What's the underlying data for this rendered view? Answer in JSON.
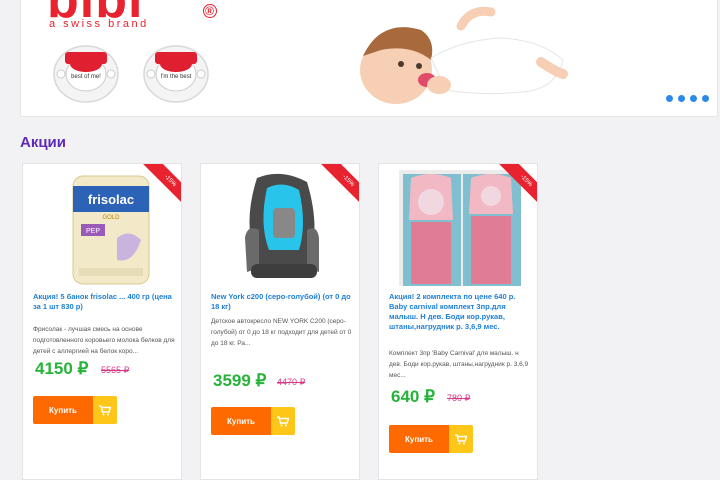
{
  "banner": {
    "brand": "bibi",
    "reg_mark": "®",
    "tagline": "a swiss brand",
    "pacifier_text_left": "best of me!",
    "pacifier_text_right": "I'm the best",
    "slider_dots": 4
  },
  "section": {
    "title": "Акции"
  },
  "products": [
    {
      "title": "Акция! 5 банок frisolac ... 400 гр (цена за 1 шт 830 р)",
      "desc": "Фрисолак - лучшая смесь на основе подготовленного коровьего молока белков для детей с аллергией на белок коро...",
      "price": "4150 ₽",
      "old_price": "5565 ₽",
      "buy_label": "Купить",
      "ribbon": "-15%",
      "image_brand": "frisolac",
      "image_sub": "GOLD",
      "image_label": "PEP"
    },
    {
      "title": "New York c200 (серо-голубой) (от 0 до 18 кг)",
      "desc": "Детское автокресло NEW YORK C200 (серо-голубой) от 0 до 18 кг подходит для детей от 0 до 18 кг. Ра...",
      "price": "3599 ₽",
      "old_price": "4470 ₽",
      "buy_label": "Купить",
      "ribbon": "-15%"
    },
    {
      "title": "Акция! 2 комплекта по цене 640 р. Baby carnival комплект 3пр.для малыш. Н дев. Боди кор.рукав, штаны,нагрудник р. 3,6,9 мес.",
      "desc": "Комплект 3пр 'Baby Carnival' для малыш. н дев. Боди кор.рукав, штаны,нагрудник р. 3,6,9 мес...",
      "price": "640 ₽",
      "old_price": "780 ₽",
      "buy_label": "Купить",
      "ribbon": "-15%"
    }
  ],
  "colors": {
    "brand_red": "#e8232f",
    "accent_purple": "#5e2ab8",
    "link_blue": "#1e7fd6",
    "price_green": "#27b23a",
    "old_price_pink": "#d83a8a",
    "buy_orange": "#ff6a00",
    "cart_yellow": "#ffc61a",
    "dot_blue": "#2a8ae6"
  },
  "icons": {
    "cart": "shopping-cart-icon",
    "dot": "slider-dot"
  }
}
